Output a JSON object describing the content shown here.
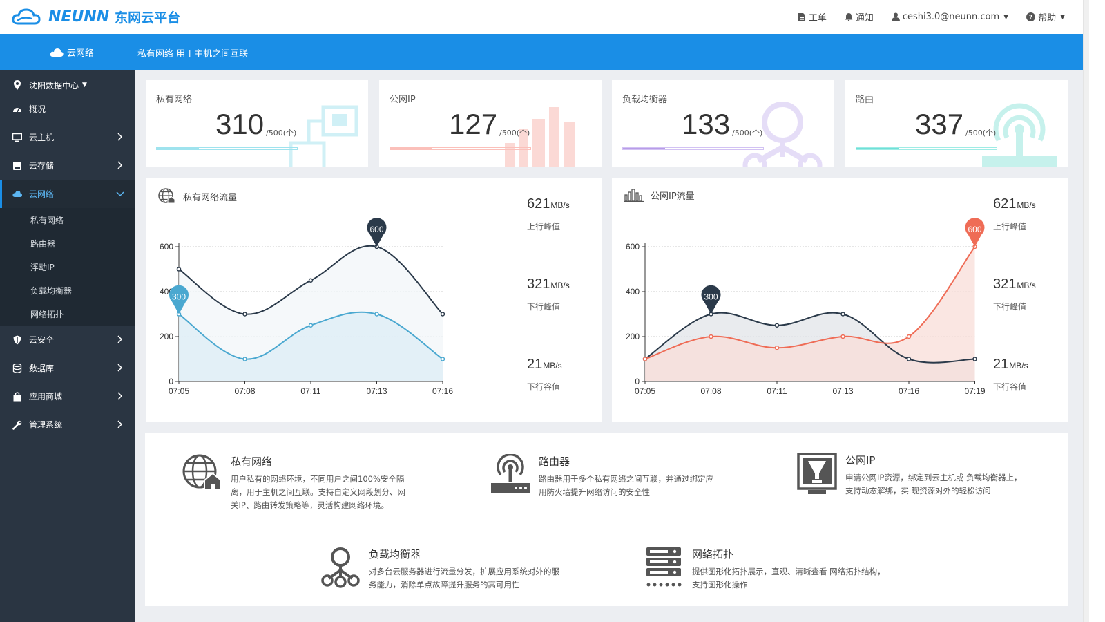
{
  "brand": {
    "logo_text": "NEUNN",
    "logo_cn": "东网云平台"
  },
  "topmenu": {
    "ticket": "工单",
    "notify": "通知",
    "user": "ceshi3.0@neunn.com",
    "help": "帮助"
  },
  "header": {
    "section": "云网络",
    "desc": "私有网络 用于主机之间互联"
  },
  "sidebar": {
    "location": "沈阳数据中心",
    "items": [
      {
        "label": "概况",
        "icon": "dashboard-icon"
      },
      {
        "label": "云主机",
        "icon": "monitor-icon"
      },
      {
        "label": "云存储",
        "icon": "storage-icon"
      },
      {
        "label": "云网络",
        "icon": "cloud-icon"
      },
      {
        "label": "云安全",
        "icon": "shield-icon"
      },
      {
        "label": "数据库",
        "icon": "database-icon"
      },
      {
        "label": "应用商城",
        "icon": "bag-icon"
      },
      {
        "label": "管理系统",
        "icon": "wrench-icon"
      }
    ],
    "sub": [
      "私有网络",
      "路由器",
      "浮动IP",
      "负载均衡器",
      "网络拓扑"
    ]
  },
  "cards": [
    {
      "label": "私有网络",
      "value": "310",
      "cap": "/500(个)",
      "fraction": 0.3,
      "color": "#9fe3ee"
    },
    {
      "label": "公网IP",
      "value": "127",
      "cap": "/500(个)",
      "fraction": 0.3,
      "color": "#fbc0ba"
    },
    {
      "label": "负载均衡器",
      "value": "133",
      "cap": "/500(个)",
      "fraction": 0.3,
      "color": "#b89ce8"
    },
    {
      "label": "路由",
      "value": "337",
      "cap": "/500(个)",
      "fraction": 0.3,
      "color": "#6fe0d8"
    }
  ],
  "chart_titles": [
    "私有网络流量",
    "公网IP流量"
  ],
  "chart_stats": [
    [
      {
        "v": "621",
        "u": "MB/s",
        "l": "上行峰值"
      },
      {
        "v": "321",
        "u": "MB/s",
        "l": "下行峰值"
      },
      {
        "v": "21",
        "u": "MB/s",
        "l": "下行谷值"
      }
    ],
    [
      {
        "v": "621",
        "u": "MB/s",
        "l": "上行峰值"
      },
      {
        "v": "321",
        "u": "MB/s",
        "l": "下行峰值"
      },
      {
        "v": "21",
        "u": "MB/s",
        "l": "下行谷值"
      }
    ]
  ],
  "chart_data": [
    {
      "type": "area",
      "title": "私有网络流量",
      "categories": [
        "07:05",
        "07:08",
        "07:11",
        "07:13",
        "07:16"
      ],
      "ylim": [
        0,
        600
      ],
      "yticks": [
        0,
        200,
        400,
        600
      ],
      "grid": true,
      "series": [
        {
          "values": [
            500,
            300,
            450,
            600,
            300
          ],
          "color": "#2b3a4a",
          "fill": "#f2f5f8",
          "marker": {
            "index": 3,
            "label": "600"
          }
        },
        {
          "values": [
            300,
            100,
            250,
            300,
            100
          ],
          "color": "#4aa8d0",
          "fill": "#dcedf5",
          "marker": {
            "index": 0,
            "label": "300"
          }
        }
      ]
    },
    {
      "type": "area",
      "title": "公网IP流量",
      "categories": [
        "07:05",
        "07:08",
        "07:11",
        "07:13",
        "07:16",
        "07:19"
      ],
      "ylim": [
        0,
        600
      ],
      "yticks": [
        0,
        200,
        400,
        600
      ],
      "grid": true,
      "series": [
        {
          "values": [
            100,
            300,
            250,
            300,
            100,
            100
          ],
          "color": "#2b3a4a",
          "fill": "#e2e4e8",
          "marker": {
            "index": 1,
            "label": "300"
          }
        },
        {
          "values": [
            100,
            200,
            150,
            200,
            200,
            600
          ],
          "color": "#ef6c56",
          "fill": "#f8ddd8",
          "marker": {
            "index": 5,
            "label": "600"
          }
        }
      ]
    }
  ],
  "info": [
    {
      "title": "私有网络",
      "desc": [
        "用户私有的网络环境，不同用户之间100%安全隔",
        "离，用于主机之间互联。支持自定义网段划分、网",
        "关IP、路由转发策略等，灵活构建网络环境。"
      ]
    },
    {
      "title": "路由器",
      "desc": [
        "路由器用于多个私有网络之间互联，并通过绑定应",
        "用防火墙提升网络访问的安全性"
      ]
    },
    {
      "title": "公网IP",
      "desc": [
        "申请公网IP资源，绑定到云主机或 负载均衡器上，",
        "支持动态解绑，实 现资源对外的轻松访问"
      ]
    },
    {
      "title": "负载均衡器",
      "desc": [
        "对多台云服务器进行流量分发，扩展应用系统对外的服",
        "务能力，消除单点故障提升服务的高可用性"
      ]
    },
    {
      "title": "网络拓扑",
      "desc": [
        "提供图形化拓扑展示，直观、清晰查看 网络拓扑结构，",
        "支持图形化操作"
      ]
    }
  ]
}
